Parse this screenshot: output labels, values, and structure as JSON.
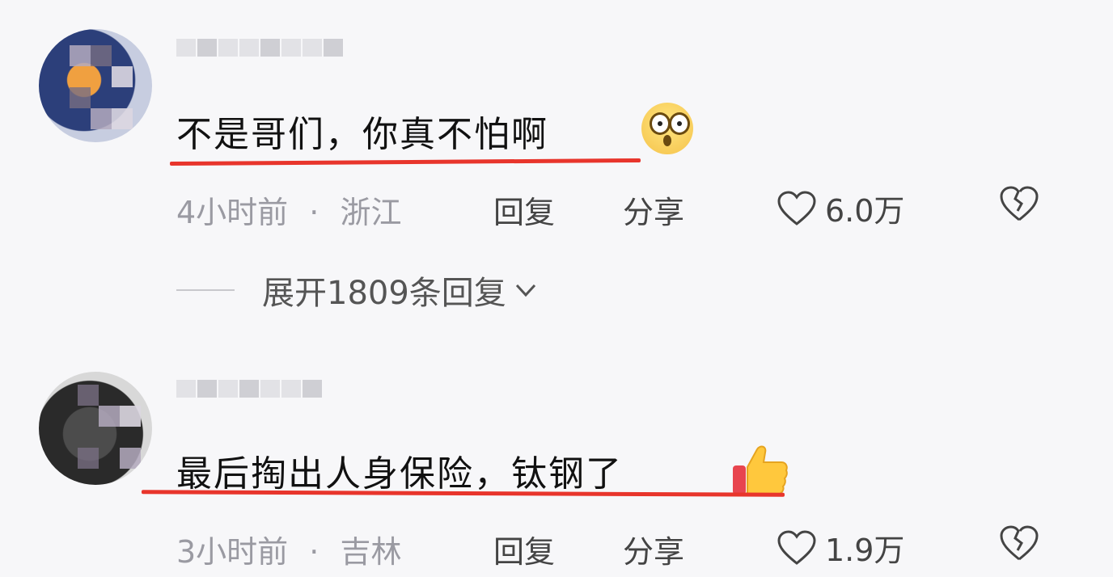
{
  "comments": [
    {
      "text": "不是哥们，你真不怕啊",
      "time": "4小时前",
      "separator": "·",
      "location": "浙江",
      "reply_label": "回复",
      "share_label": "分享",
      "likes": "6.0万",
      "emoji": "astonished-face-icon"
    },
    {
      "text": "最后掏出人身保险，钛钢了",
      "time": "3小时前",
      "separator": "·",
      "location": "吉林",
      "reply_label": "回复",
      "share_label": "分享",
      "likes": "1.9万",
      "emoji": "thumbs-up-icon"
    }
  ],
  "expand_replies": {
    "label": "展开1809条回复"
  },
  "colors": {
    "underline": "#e8352c",
    "background": "#f7f7f9"
  }
}
